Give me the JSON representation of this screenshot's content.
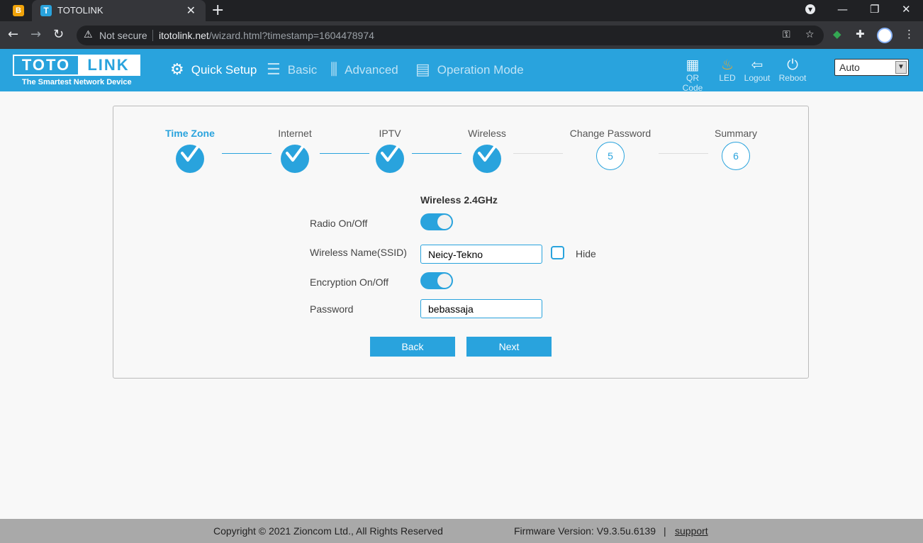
{
  "browser": {
    "tab_title": "TOTOLINK",
    "security_label": "Not secure",
    "url_host": "itotolink.net",
    "url_path": "/wizard.html?timestamp=1604478974"
  },
  "header": {
    "logo_left": "TOTO",
    "logo_right": "LINK",
    "tagline": "The Smartest Network Device",
    "nav": [
      {
        "label": "Quick Setup",
        "icon": "gear-icon"
      },
      {
        "label": "Basic",
        "icon": "list-icon"
      },
      {
        "label": "Advanced",
        "icon": "sliders-icon"
      },
      {
        "label": "Operation Mode",
        "icon": "screens-icon"
      }
    ],
    "tools": [
      {
        "label": "QR Code",
        "icon": "qr-code-icon"
      },
      {
        "label": "LED",
        "icon": "led-icon"
      },
      {
        "label": "Logout",
        "icon": "logout-icon"
      },
      {
        "label": "Reboot",
        "icon": "power-icon"
      }
    ],
    "language_selected": "Auto"
  },
  "wizard": {
    "steps": [
      {
        "label": "Time Zone",
        "status": "done",
        "current": true
      },
      {
        "label": "Internet",
        "status": "done"
      },
      {
        "label": "IPTV",
        "status": "done"
      },
      {
        "label": "Wireless",
        "status": "done"
      },
      {
        "label": "Change Password",
        "status": "todo",
        "number": "5"
      },
      {
        "label": "Summary",
        "status": "todo",
        "number": "6"
      }
    ],
    "section_title": "Wireless 2.4GHz",
    "radio_label": "Radio On/Off",
    "radio_on": true,
    "ssid_label": "Wireless Name(SSID)",
    "ssid_value": "Neicy-Tekno",
    "hide_label": "Hide",
    "hide_checked": false,
    "encryption_label": "Encryption On/Off",
    "encryption_on": true,
    "password_label": "Password",
    "password_value": "bebassaja",
    "back_label": "Back",
    "next_label": "Next"
  },
  "footer": {
    "copyright": "Copyright © 2021 Zioncom Ltd., All Rights Reserved",
    "firmware": "Firmware Version: V9.3.5u.6139",
    "separator": "|",
    "support": "support"
  },
  "colors": {
    "accent": "#29a3dd",
    "led": "#f5a623"
  }
}
